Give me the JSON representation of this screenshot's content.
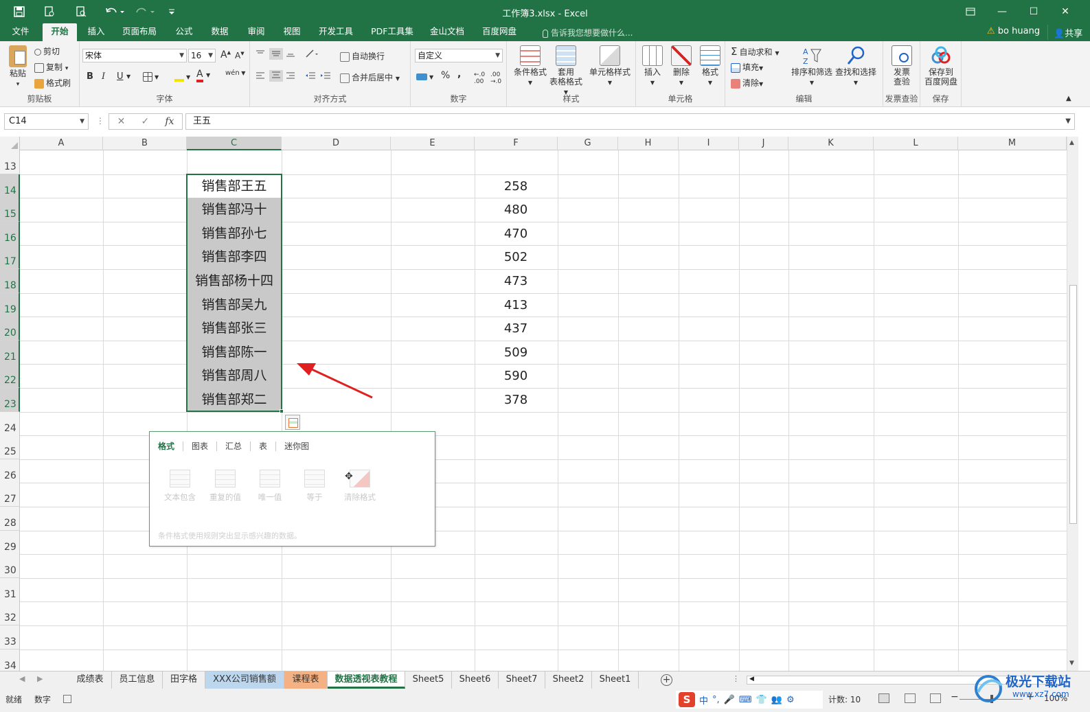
{
  "window": {
    "title": "工作簿3.xlsx - Excel",
    "restore_icon": "restore-icon",
    "minimize": "—",
    "maximize": "☐",
    "close": "✕"
  },
  "quick_access": [
    "save-icon",
    "print-preview-icon",
    "search-preview-icon",
    "undo-icon",
    "redo-icon",
    "customize-icon"
  ],
  "ribbon_tabs": [
    "文件",
    "开始",
    "插入",
    "页面布局",
    "公式",
    "数据",
    "审阅",
    "视图",
    "开发工具",
    "PDF工具集",
    "金山文档",
    "百度网盘"
  ],
  "active_tab": "开始",
  "tell_me": "告诉我您想要做什么...",
  "user": {
    "name": "bo huang",
    "share": "共享"
  },
  "ribbon": {
    "clipboard": {
      "paste": "粘贴",
      "cut": "剪切",
      "copy": "复制",
      "format_painter": "格式刷",
      "label": "剪贴板"
    },
    "font": {
      "name": "宋体",
      "size": "16",
      "bold": "B",
      "italic": "I",
      "underline": "U",
      "grow": "A",
      "shrink": "A",
      "label": "字体",
      "phonetic": "wén"
    },
    "alignment": {
      "wrap": "自动换行",
      "merge": "合并后居中",
      "label": "对齐方式"
    },
    "number": {
      "format": "自定义",
      "percent": "%",
      "comma": ",",
      "label": "数字"
    },
    "styles": {
      "conditional": "条件格式",
      "table_line1": "套用",
      "table_line2": "表格格式",
      "cell_styles": "单元格样式",
      "label": "样式"
    },
    "cells": {
      "insert": "插入",
      "delete": "删除",
      "format": "格式",
      "label": "单元格"
    },
    "editing": {
      "autosum": "自动求和",
      "fill": "填充",
      "clear": "清除",
      "sort": "排序和筛选",
      "find": "查找和选择",
      "label": "编辑"
    },
    "invoice": {
      "btn_line1": "发票",
      "btn_line2": "查验",
      "label": "发票查验"
    },
    "save": {
      "btn_line1": "保存到",
      "btn_line2": "百度网盘",
      "label": "保存"
    }
  },
  "formula_bar": {
    "name_box": "C14",
    "cancel": "✕",
    "enter": "✓",
    "fx": "fx",
    "value": "王五"
  },
  "columns": [
    "A",
    "B",
    "C",
    "D",
    "E",
    "F",
    "G",
    "H",
    "I",
    "J",
    "K",
    "L",
    "M"
  ],
  "selected_column": "C",
  "rows": [
    "13",
    "14",
    "15",
    "16",
    "17",
    "18",
    "19",
    "20",
    "21",
    "22",
    "23",
    "24",
    "25",
    "26",
    "27",
    "28",
    "29",
    "30",
    "31",
    "32",
    "33",
    "34"
  ],
  "cells_C": [
    "销售部王五",
    "销售部冯十",
    "销售部孙七",
    "销售部李四",
    "销售部杨十四",
    "销售部吴九",
    "销售部张三",
    "销售部陈一",
    "销售部周八",
    "销售部郑二"
  ],
  "cells_F": [
    "258",
    "480",
    "470",
    "502",
    "473",
    "413",
    "437",
    "509",
    "590",
    "378"
  ],
  "quick_analysis": {
    "tabs": [
      "格式",
      "图表",
      "汇总",
      "表",
      "迷你图"
    ],
    "active_tab": "格式",
    "options": [
      "文本包含",
      "重复的值",
      "唯一值",
      "等于",
      "清除格式"
    ],
    "description": "条件格式使用规则突出显示感兴趣的数据。"
  },
  "annotation_color": "#e02020",
  "sheet_tabs": [
    {
      "name": "成绩表",
      "style": "normal"
    },
    {
      "name": "员工信息",
      "style": "normal"
    },
    {
      "name": "田字格",
      "style": "normal"
    },
    {
      "name": "XXX公司销售额",
      "style": "blue"
    },
    {
      "name": "课程表",
      "style": "orange"
    },
    {
      "name": "数据透视表教程",
      "style": "active"
    },
    {
      "name": "Sheet5",
      "style": "normal"
    },
    {
      "name": "Sheet6",
      "style": "normal"
    },
    {
      "name": "Sheet7",
      "style": "normal"
    },
    {
      "name": "Sheet2",
      "style": "normal"
    },
    {
      "name": "Sheet1",
      "style": "normal"
    }
  ],
  "add_sheet": "+",
  "status": {
    "mode": "就绪",
    "num": "数字",
    "ime": [
      "S",
      "中",
      "°,",
      "🎤",
      "⌨",
      "👕",
      "👥",
      "⚙"
    ],
    "count": "计数: 10",
    "zoom": "100%",
    "zoom_minus": "−",
    "zoom_plus": "+"
  },
  "watermark": {
    "text": "极光下载站",
    "url": "www.xz7.com"
  }
}
